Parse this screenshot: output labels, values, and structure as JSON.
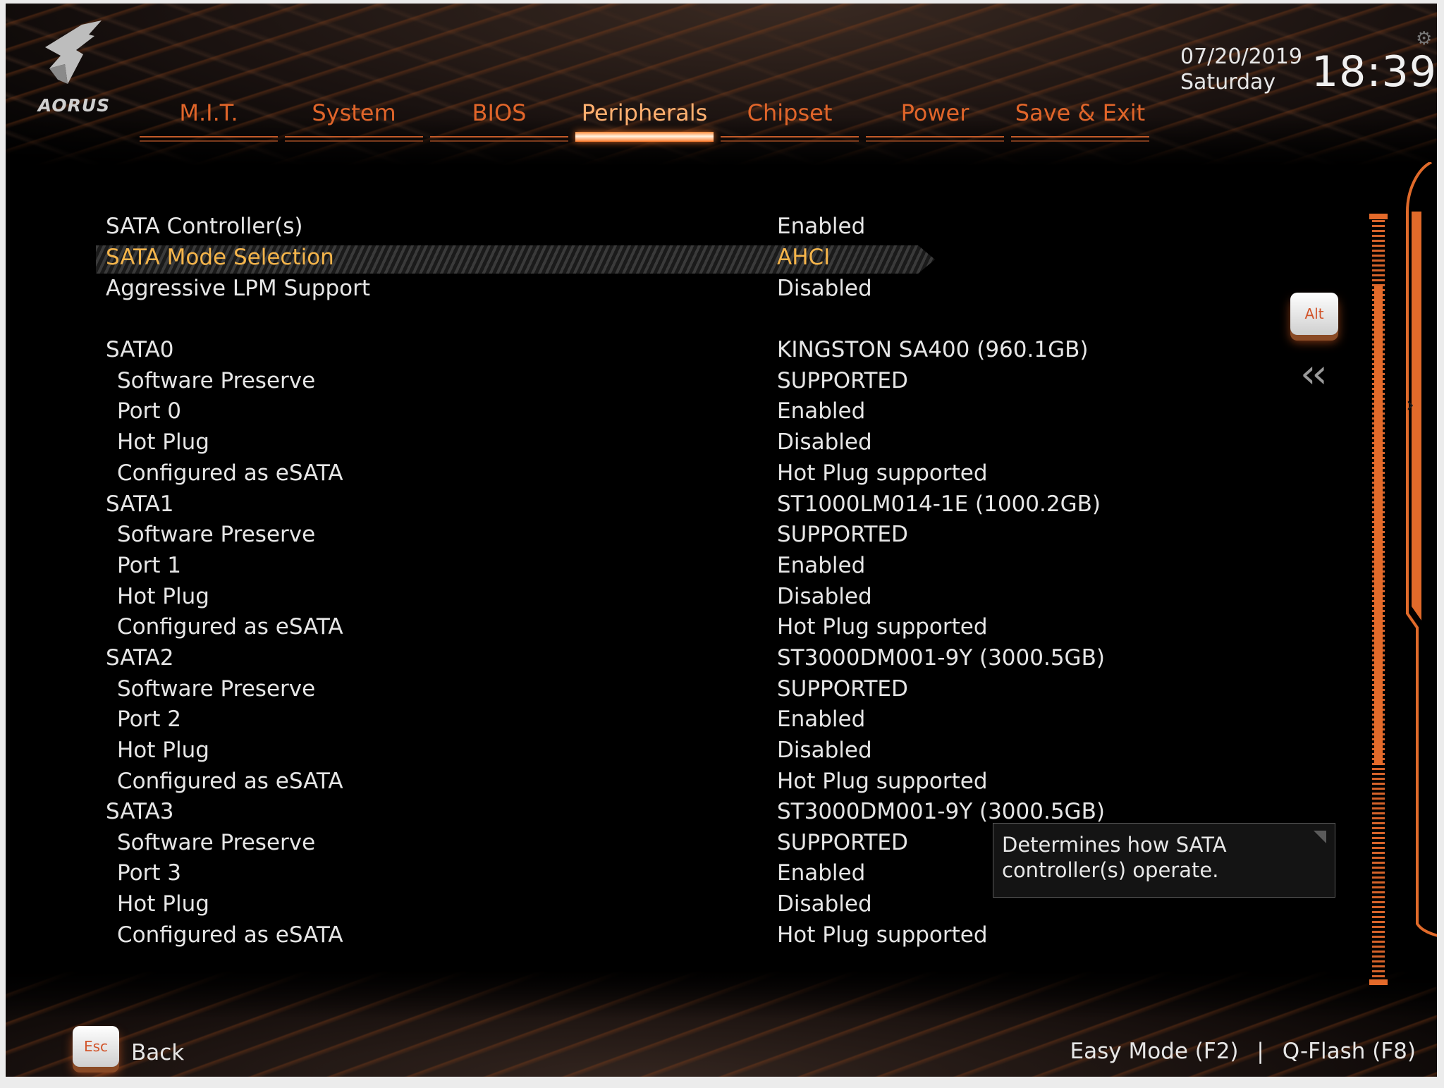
{
  "brand": {
    "logo_text": "AORUS"
  },
  "header": {
    "date": "07/20/2019",
    "day": "Saturday",
    "time": "18:39"
  },
  "tabs": [
    {
      "label": "M.I.T."
    },
    {
      "label": "System"
    },
    {
      "label": "BIOS"
    },
    {
      "label": "Peripherals",
      "active": true
    },
    {
      "label": "Chipset"
    },
    {
      "label": "Power"
    },
    {
      "label": "Save & Exit"
    }
  ],
  "settings": [
    {
      "label": "SATA Controller(s)",
      "value": "Enabled"
    },
    {
      "label": "SATA Mode Selection",
      "value": "AHCI",
      "selected": true
    },
    {
      "label": "Aggressive LPM Support",
      "value": "Disabled"
    },
    {
      "label": "SATA0",
      "value": "KINGSTON SA400 (960.1GB)"
    },
    {
      "label": "Software Preserve",
      "value": "SUPPORTED"
    },
    {
      "label": "Port 0",
      "value": "Enabled"
    },
    {
      "label": "Hot Plug",
      "value": "Disabled"
    },
    {
      "label": "Configured as eSATA",
      "value": "Hot Plug supported"
    },
    {
      "label": "SATA1",
      "value": "ST1000LM014-1E (1000.2GB)"
    },
    {
      "label": "Software Preserve",
      "value": "SUPPORTED"
    },
    {
      "label": "Port 1",
      "value": "Enabled"
    },
    {
      "label": "Hot Plug",
      "value": "Disabled"
    },
    {
      "label": "Configured as eSATA",
      "value": "Hot Plug supported"
    },
    {
      "label": "SATA2",
      "value": "ST3000DM001-9Y (3000.5GB)"
    },
    {
      "label": "Software Preserve",
      "value": "SUPPORTED"
    },
    {
      "label": "Port 2",
      "value": "Enabled"
    },
    {
      "label": "Hot Plug",
      "value": "Disabled"
    },
    {
      "label": "Configured as eSATA",
      "value": "Hot Plug supported"
    },
    {
      "label": "SATA3",
      "value": "ST3000DM001-9Y (3000.5GB)"
    },
    {
      "label": "Software Preserve",
      "value": "SUPPORTED"
    },
    {
      "label": "Port 3",
      "value": "Enabled"
    },
    {
      "label": "Hot Plug",
      "value": "Disabled"
    },
    {
      "label": "Configured as eSATA",
      "value": "Hot Plug supported"
    }
  ],
  "help": {
    "text_line1": "Determines how SATA",
    "text_line2": "controller(s) operate."
  },
  "keys": {
    "alt": "Alt",
    "esc": "Esc"
  },
  "footer": {
    "back": "Back",
    "easy_mode": "Easy Mode (F2)",
    "separator": "|",
    "qflash": "Q-Flash (F8)"
  },
  "icons": {
    "collapse": "double-chevron-left-icon",
    "gear": "gear-icon",
    "side_arrow": "chevron-right-icon"
  },
  "colors": {
    "accent": "#e0652a",
    "selected_text": "#f5b54b",
    "text": "#e6e6e6",
    "background": "#000000"
  }
}
